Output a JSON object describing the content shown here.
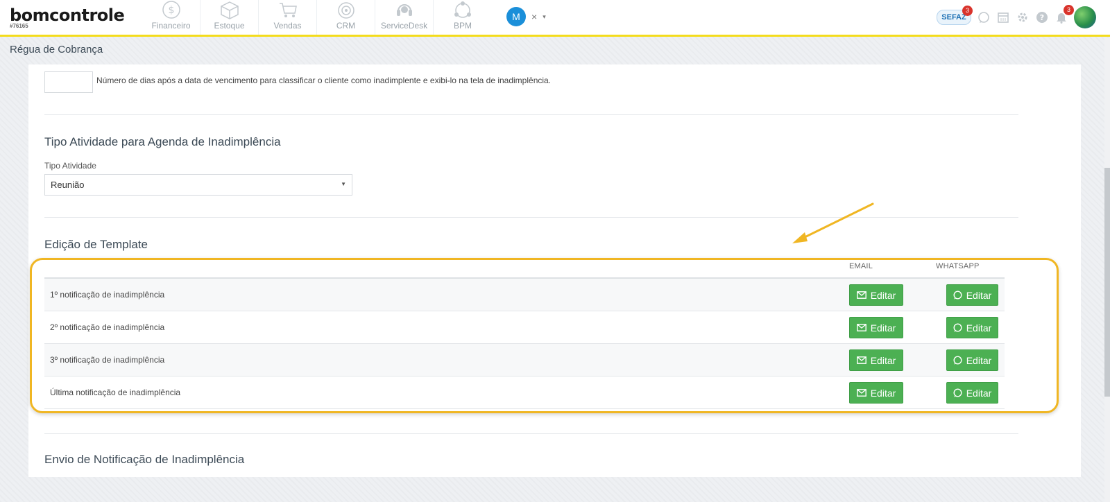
{
  "brand": {
    "logo_text": "bomcontrole",
    "account_id": "#76165"
  },
  "nav": {
    "modules": [
      {
        "label": "Financeiro",
        "icon": "dollar-icon"
      },
      {
        "label": "Estoque",
        "icon": "box-icon"
      },
      {
        "label": "Vendas",
        "icon": "cart-icon"
      },
      {
        "label": "CRM",
        "icon": "target-icon"
      },
      {
        "label": "ServiceDesk",
        "icon": "headset-icon"
      },
      {
        "label": "BPM",
        "icon": "flow-icon"
      }
    ],
    "user_initial": "M",
    "close_symbol": "×",
    "caret_symbol": "▾",
    "sefaz_label": "SEFAZ",
    "sefaz_badge": "3",
    "notifications_badge": "3"
  },
  "page": {
    "title": "Régua de Cobrança"
  },
  "overdue": {
    "days_value": "",
    "helper_text": "Número de dias após a data de vencimento para classificar o cliente como inadimplente e exibi-lo na tela de inadimplência."
  },
  "activity": {
    "section_title": "Tipo Atividade para Agenda de Inadimplência",
    "field_label": "Tipo Atividade",
    "selected_value": "Reunião"
  },
  "templates": {
    "section_title": "Edição de Template",
    "col_email": "EMAIL",
    "col_whatsapp": "WHATSAPP",
    "button_label": "Editar",
    "rows": [
      {
        "label": "1º notificação de inadimplência"
      },
      {
        "label": "2º notificação de inadimplência"
      },
      {
        "label": "3º notificação de inadimplência"
      },
      {
        "label": "Última notificação de inadimplência"
      }
    ]
  },
  "notification_send": {
    "section_title": "Envio de Notificação de Inadimplência"
  },
  "colors": {
    "accent_yellow": "#f4dc1c",
    "button_green": "#4cb053",
    "highlight_orange": "#f0b623",
    "badge_red": "#d9332b",
    "avatar_blue": "#1b8fd9"
  }
}
